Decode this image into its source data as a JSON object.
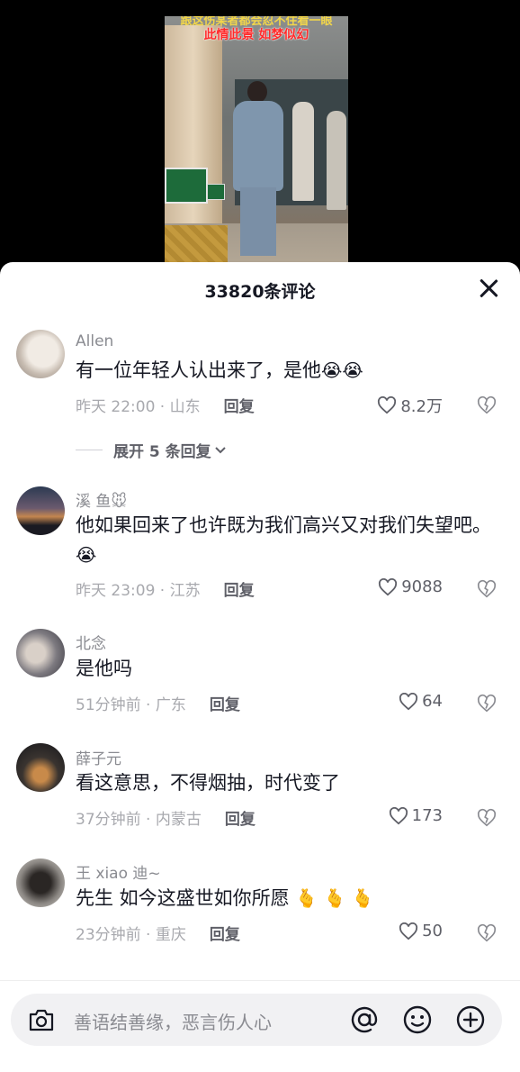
{
  "video": {
    "caption_top": "跟这伤某者都会忍不住看一眼",
    "caption": "此情此景 如梦似幻"
  },
  "sheet": {
    "title": "33820条评论"
  },
  "comments": [
    {
      "name": "Allen",
      "text": "有一位年轻人认出来了，是他",
      "emoji": "😭😭",
      "time": "昨天 22:00 · 山东",
      "reply": "回复",
      "likes": "8.2万"
    },
    {
      "name": "溪 鱼🐭",
      "text": "他如果回来了也许既为我们高兴又对我们失望吧。",
      "emoji": "😭",
      "time": "昨天 23:09 · 江苏",
      "reply": "回复",
      "likes": "9088"
    },
    {
      "name": "北念",
      "text": "是他吗",
      "emoji": "",
      "time": "51分钟前 · 广东",
      "reply": "回复",
      "likes": "64"
    },
    {
      "name": "薛子元",
      "text": "看这意思，不得烟抽，时代变了",
      "emoji": "",
      "time": "37分钟前 · 内蒙古",
      "reply": "回复",
      "likes": "173"
    },
    {
      "name": "王 xiao 迪~",
      "text": "先生 如今这盛世如你所愿",
      "emoji": "🫰 🫰 🫰",
      "time": "23分钟前 · 重庆",
      "reply": "回复",
      "likes": "50"
    }
  ],
  "expand": {
    "label": "展开 5 条回复"
  },
  "input": {
    "placeholder": "善语结善缘，恶言伤人心"
  }
}
